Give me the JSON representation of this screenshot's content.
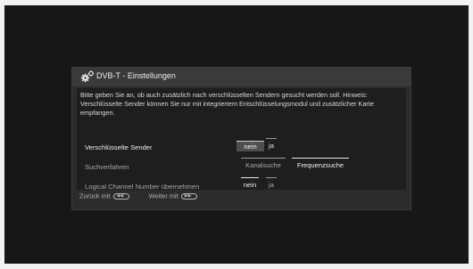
{
  "dialog": {
    "title": "DVB-T - Einstellungen",
    "hint": "Bitte geben Sie an, ob auch zusätzlich nach verschlüsselten Sendern gesucht werden soll. Hinweis: Verschlüsselte Sender können Sie nur mit integriertem Entschlüsselungsmodul und zusätzlicher Karte empfangen."
  },
  "settings": [
    {
      "label": "Verschlüsselte Sender",
      "active": true,
      "options": [
        {
          "label": "nein",
          "selected": true
        },
        {
          "label": "ja",
          "selected": false
        }
      ]
    },
    {
      "label": "Suchverfahren",
      "active": false,
      "options": [
        {
          "label": "Kanalsuche",
          "selected": false
        },
        {
          "label": "Frequenzsuche",
          "selected": true
        }
      ]
    },
    {
      "label": "Logical Channel Number übernehmen",
      "active": false,
      "options": [
        {
          "label": "nein",
          "selected": true
        },
        {
          "label": "ja",
          "selected": false
        }
      ]
    }
  ],
  "footer": {
    "back_label": "Zurück mit",
    "back_icon": "rewind-button-icon",
    "next_label": "Weiter mit",
    "next_icon": "fast-forward-button-icon"
  },
  "colors": {
    "background": "#171717",
    "panel": "#2c2c2c",
    "content": "#1e1e1e",
    "text_active": "#f0f0f0",
    "text_inactive": "#a8a8a8",
    "selection": "#4f4f4f"
  }
}
